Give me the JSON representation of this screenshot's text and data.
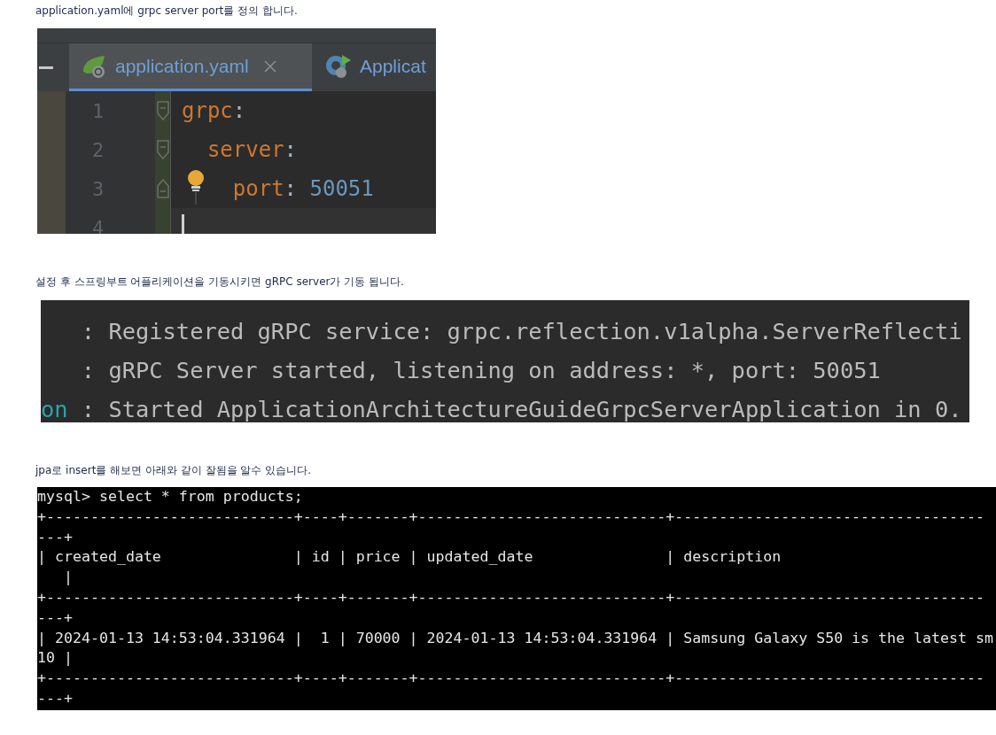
{
  "caption_1": "application.yaml에 grpc server port를 정의 합니다.",
  "ide": {
    "tabs": [
      {
        "label": "application.yaml",
        "selected": true,
        "kind": "leaf"
      },
      {
        "label": "Applicat",
        "selected": false,
        "kind": "app"
      }
    ],
    "lines": [
      {
        "number": "1",
        "key": "grpc",
        "colon": ":",
        "kind": "opener",
        "current": false,
        "children": [
          {
            "number": "2",
            "key": "server",
            "colon": ":",
            "kind": "opener",
            "current": false,
            "children": [
              {
                "number": "3",
                "key": "port",
                "colon": ":",
                "value": "50051",
                "kind": "closer",
                "current": false,
                "hint": true
              }
            ]
          }
        ]
      },
      {
        "number": "4",
        "kind": "blank",
        "current": true
      }
    ]
  },
  "caption_2": "설정 후 스프링부트 어플리케이션을 기동시키면 gRPC server가 기동 됩니다.",
  "console": {
    "lines": [
      {
        "text": ": Registered gRPC service: grpc.reflection.v1alpha.ServerReflecti"
      },
      {
        "text": ": gRPC Server started, listening on address: *, port: 50051"
      },
      {
        "prefix": "on",
        "text": ": Started ApplicationArchitectureGuideGrpcServerApplication in 0."
      }
    ]
  },
  "caption_3": "jpa로 insert를 해보면 아래와 같이 잘됨을 알수 있습니다.",
  "terminal": {
    "lines": [
      "mysql> select * from products;",
      "+----------------------------+----+-------+----------------------------+-----------------------------------",
      "---+",
      "| created_date               | id | price | updated_date               | description",
      "   |",
      "+----------------------------+----+-------+----------------------------+-----------------------------------",
      "---+",
      "| 2024-01-13 14:53:04.331964 |  1 | 70000 | 2024-01-13 14:53:04.331964 | Samsung Galaxy S50 is the latest sm",
      "10 |",
      "+----------------------------+----+-------+----------------------------+-----------------------------------",
      "---+"
    ]
  }
}
